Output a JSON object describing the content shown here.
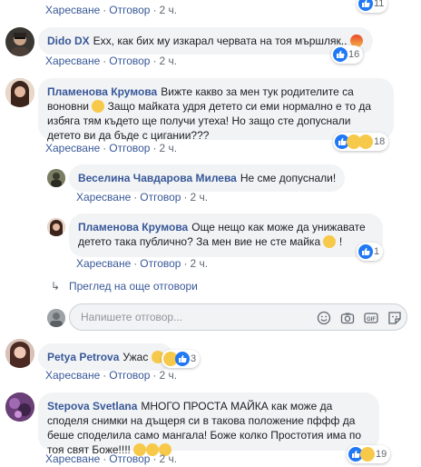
{
  "actions": {
    "like": "Харесване",
    "reply": "Отговор",
    "time": "2 ч.",
    "sep": "·"
  },
  "comments": [
    {
      "author": "",
      "text": "",
      "count": "11"
    },
    {
      "author": "Dido DX",
      "text": "Ехх, как бих му изкарал червата на тоя мършляк..",
      "count": "16"
    },
    {
      "author": "Пламенова Крумова",
      "text": "Вижте какво за мен тук родителите са воновни",
      "text2": "Защо майката удря детето си еми нормално е то да избягa тям където ще получи утеха! Но защо сте допуснали детето ви да бъде с цигании???",
      "count": "18"
    },
    {
      "author": "Веселина Чавдарова Милева",
      "text": "Не сме допуснали!"
    },
    {
      "author": "Пламенова Крумова",
      "text": "Още нещо как може да унижавате детето така публично? За мен вие не сте майка",
      "text_end": "!",
      "count": "1"
    },
    {
      "author": "Petya Petrova",
      "text": "Ужас",
      "count": "3"
    },
    {
      "author": "Stepova Svetlana",
      "text": "МНОГО ПРОСТА МАЙКА как може да споделя снимки на дъщеря си в такова положение пффф да беше споделила само мангала! Боже колко Простотия има по тоя свят Боже!!!!",
      "count": "19"
    }
  ],
  "view_more_replies": "Преглед на още отговори",
  "reply_placeholder": "Напишете отговор...",
  "icons": [
    "like-icon",
    "haha-icon",
    "sad-icon",
    "angry-icon",
    "smiley-icon",
    "camera-icon",
    "gif-icon",
    "sticker-icon",
    "reply-arrow-icon"
  ],
  "colors": {
    "link": "#385898",
    "bubble": "#f2f3f5",
    "like_blue": "#2078f4",
    "muted": "#606770"
  }
}
